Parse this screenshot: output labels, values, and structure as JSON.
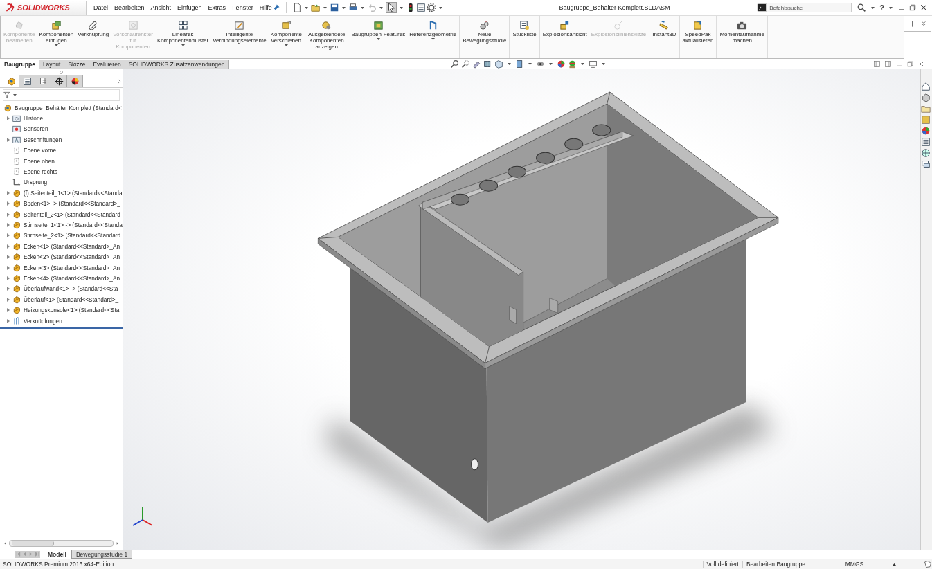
{
  "app": {
    "logo": "SOLIDWORKS"
  },
  "menu": [
    "Datei",
    "Bearbeiten",
    "Ansicht",
    "Einfügen",
    "Extras",
    "Fenster",
    "Hilfe"
  ],
  "window": {
    "title": "Baugruppe_Behälter Komplett.SLDASM"
  },
  "search": {
    "placeholder": "Befehlssuche"
  },
  "help": "?",
  "ribbon": {
    "groups": [
      {
        "items": [
          {
            "label": "Komponente\nbearbeiten",
            "disabled": true,
            "dropdown": false
          },
          {
            "label": "Komponenten\neinfügen",
            "disabled": false,
            "dropdown": true
          },
          {
            "label": "Verknüpfung",
            "disabled": false,
            "dropdown": false
          },
          {
            "label": "Vorschaufenster\nfür\nKomponenten",
            "disabled": true,
            "dropdown": false
          },
          {
            "label": "Lineares\nKomponentenmuster",
            "disabled": false,
            "dropdown": true
          },
          {
            "label": "Intelligente\nVerbindungselemente",
            "disabled": false,
            "dropdown": false
          },
          {
            "label": "Komponente\nverschieben",
            "disabled": false,
            "dropdown": true
          }
        ]
      },
      {
        "items": [
          {
            "label": "Ausgeblendete\nKomponenten\nanzeigen",
            "disabled": false,
            "dropdown": false
          }
        ]
      },
      {
        "items": [
          {
            "label": "Baugruppen-Features",
            "disabled": false,
            "dropdown": true
          },
          {
            "label": "Referenzgeometrie",
            "disabled": false,
            "dropdown": true
          }
        ]
      },
      {
        "items": [
          {
            "label": "Neue\nBewegungsstudie",
            "disabled": false,
            "dropdown": false
          }
        ]
      },
      {
        "items": [
          {
            "label": "Stückliste",
            "disabled": false,
            "dropdown": false
          }
        ]
      },
      {
        "items": [
          {
            "label": "Explosionsansicht",
            "disabled": false,
            "dropdown": false
          },
          {
            "label": "Explosionslinienskizze",
            "disabled": true,
            "dropdown": false
          }
        ]
      },
      {
        "items": [
          {
            "label": "Instant3D",
            "disabled": false,
            "dropdown": false
          }
        ]
      },
      {
        "items": [
          {
            "label": "SpeedPak\naktualisieren",
            "disabled": false,
            "dropdown": false
          }
        ]
      },
      {
        "items": [
          {
            "label": "Momentaufnahme\nmachen",
            "disabled": false,
            "dropdown": false
          }
        ]
      }
    ]
  },
  "tabs": [
    {
      "label": "Baugruppe",
      "selected": true
    },
    {
      "label": "Layout",
      "selected": false
    },
    {
      "label": "Skizze",
      "selected": false
    },
    {
      "label": "Evaluieren",
      "selected": false
    },
    {
      "label": "SOLIDWORKS Zusatzanwendungen",
      "selected": false
    }
  ],
  "panel_tabs": [
    {
      "selected": true
    },
    {
      "selected": false
    },
    {
      "selected": false
    },
    {
      "selected": false
    },
    {
      "selected": false
    }
  ],
  "tree": {
    "root": {
      "label": "Baugruppe_Behälter Komplett  (Standard<",
      "children": [
        {
          "label": "Historie",
          "kind": "history",
          "collapsible": true
        },
        {
          "label": "Sensoren",
          "kind": "sensor",
          "collapsible": false
        },
        {
          "label": "Beschriftungen",
          "kind": "annotation",
          "collapsible": true
        },
        {
          "label": "Ebene vorne",
          "kind": "plane",
          "collapsible": false
        },
        {
          "label": "Ebene oben",
          "kind": "plane",
          "collapsible": false
        },
        {
          "label": "Ebene rechts",
          "kind": "plane",
          "collapsible": false
        },
        {
          "label": "Ursprung",
          "kind": "origin",
          "collapsible": false
        },
        {
          "label": "(f) Seitenteil_1<1> (Standard<<Standa",
          "kind": "part",
          "collapsible": true
        },
        {
          "label": "Boden<1> -> (Standard<<Standard>_",
          "kind": "part",
          "collapsible": true
        },
        {
          "label": "Seitenteil_2<1> (Standard<<Standard",
          "kind": "part",
          "collapsible": true
        },
        {
          "label": "Stirnseite_1<1> -> (Standard<<Standa",
          "kind": "part",
          "collapsible": true
        },
        {
          "label": "Stirnseite_2<1> (Standard<<Standard",
          "kind": "part",
          "collapsible": true
        },
        {
          "label": "Ecken<1> (Standard<<Standard>_An",
          "kind": "part",
          "collapsible": true
        },
        {
          "label": "Ecken<2> (Standard<<Standard>_An",
          "kind": "part",
          "collapsible": true
        },
        {
          "label": "Ecken<3> (Standard<<Standard>_An",
          "kind": "part",
          "collapsible": true
        },
        {
          "label": "Ecken<4> (Standard<<Standard>_An",
          "kind": "part",
          "collapsible": true
        },
        {
          "label": "Überlaufwand<1> -> (Standard<<Sta",
          "kind": "part",
          "collapsible": true
        },
        {
          "label": "Überlauf<1> (Standard<<Standard>_",
          "kind": "part",
          "collapsible": true
        },
        {
          "label": "Heizungskonsole<1> (Standard<<Sta",
          "kind": "part",
          "collapsible": true
        },
        {
          "label": "Verknüpfungen",
          "kind": "mates",
          "collapsible": true
        }
      ]
    }
  },
  "bottom_tabs": [
    {
      "label": "Modell",
      "selected": true
    },
    {
      "label": "Bewegungsstudie 1",
      "selected": false
    }
  ],
  "status_bar": {
    "edition": "SOLIDWORKS Premium 2016 x64-Edition",
    "state": "Voll definiert",
    "mode": "Bearbeiten Baugruppe",
    "units": "MMGS"
  }
}
